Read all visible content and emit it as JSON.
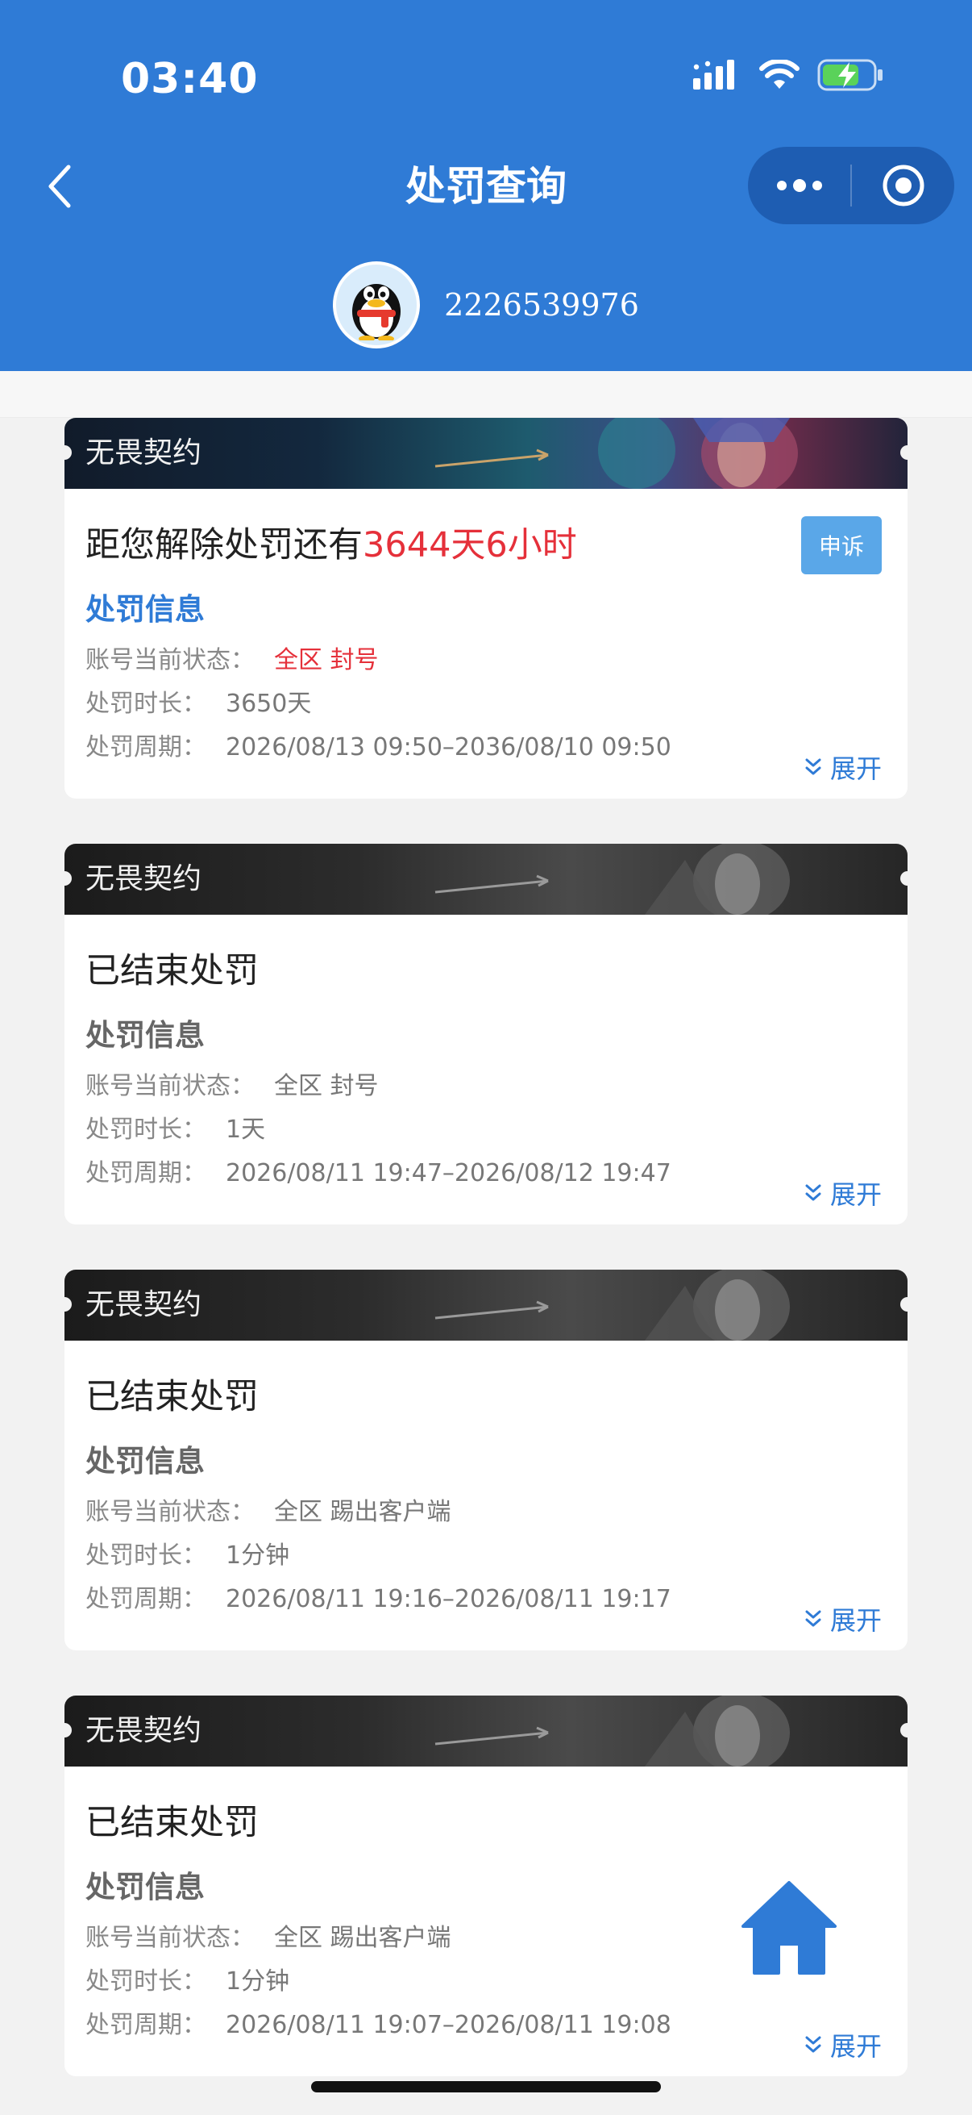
{
  "status_bar": {
    "time": "03:40"
  },
  "nav": {
    "title": "处罚查询"
  },
  "user": {
    "id": "2226539976"
  },
  "cards": [
    {
      "banner": "无畏契约",
      "title_prefix": "距您解除处罚还有",
      "title_highlight": "3644天6小时",
      "appeal_label": "申诉",
      "section_title": "处罚信息",
      "status_label": "账号当前状态：",
      "status_value": "全区 封号",
      "duration_label": "处罚时长：",
      "duration_value": "3650天",
      "period_label": "处罚周期：",
      "period_value": "2026/08/13 09:50–2036/08/10 09:50",
      "expand_label": "展开"
    },
    {
      "banner": "无畏契约",
      "title": "已结束处罚",
      "section_title": "处罚信息",
      "status_label": "账号当前状态：",
      "status_value": "全区 封号",
      "duration_label": "处罚时长：",
      "duration_value": "1天",
      "period_label": "处罚周期：",
      "period_value": "2026/08/11 19:47–2026/08/12 19:47",
      "expand_label": "展开"
    },
    {
      "banner": "无畏契约",
      "title": "已结束处罚",
      "section_title": "处罚信息",
      "status_label": "账号当前状态：",
      "status_value": "全区 踢出客户端",
      "duration_label": "处罚时长：",
      "duration_value": "1分钟",
      "period_label": "处罚周期：",
      "period_value": "2026/08/11 19:16–2026/08/11 19:17",
      "expand_label": "展开"
    },
    {
      "banner": "无畏契约",
      "title": "已结束处罚",
      "section_title": "处罚信息",
      "status_label": "账号当前状态：",
      "status_value": "全区 踢出客户端",
      "duration_label": "处罚时长：",
      "duration_value": "1分钟",
      "period_label": "处罚周期：",
      "period_value": "2026/08/11 19:07–2026/08/11 19:08",
      "expand_label": "展开"
    }
  ],
  "colors": {
    "header": "#2f7bd6",
    "accent_red": "#e5303a",
    "appeal_button": "#5aa7e8",
    "link_blue": "#2f7bd6"
  },
  "icons": {
    "back": "chevron-left-icon",
    "more": "more-dots-icon",
    "close_miniprogram": "target-circle-icon",
    "expand": "double-chevron-down-icon",
    "home": "home-icon"
  }
}
